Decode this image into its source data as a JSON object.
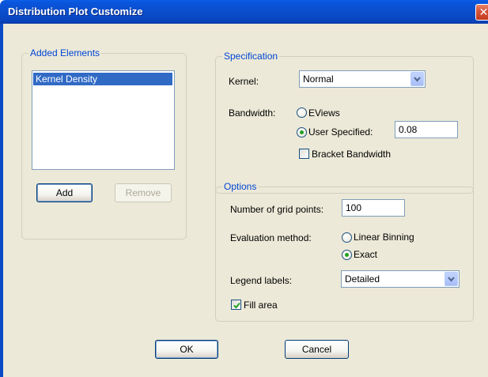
{
  "window": {
    "title": "Distribution Plot Customize",
    "close_glyph": "✕"
  },
  "added_elements": {
    "legend": "Added Elements",
    "items": [
      "Kernel Density"
    ],
    "add_label": "Add",
    "remove_label": "Remove"
  },
  "specification": {
    "legend": "Specification",
    "kernel_label": "Kernel:",
    "kernel_value": "Normal",
    "bandwidth_label": "Bandwidth:",
    "bandwidth_options": [
      "EViews",
      "User Specified:"
    ],
    "bandwidth_selected": "User Specified:",
    "bandwidth_value": "0.08",
    "bracket_label": "Bracket Bandwidth",
    "bracket_checked": false
  },
  "options": {
    "legend": "Options",
    "grid_points_label": "Number of grid points:",
    "grid_points_value": "100",
    "eval_label": "Evaluation method:",
    "eval_options": [
      "Linear Binning",
      "Exact"
    ],
    "eval_selected": "Exact",
    "legend_labels_label": "Legend labels:",
    "legend_labels_value": "Detailed",
    "fill_area_label": "Fill area",
    "fill_area_checked": true
  },
  "footer": {
    "ok_label": "OK",
    "cancel_label": "Cancel"
  },
  "colors": {
    "titlebar": "#0a4ac4",
    "legend_text": "#0046d5",
    "selection": "#316ac5",
    "dialog_bg": "#ece9d8"
  }
}
